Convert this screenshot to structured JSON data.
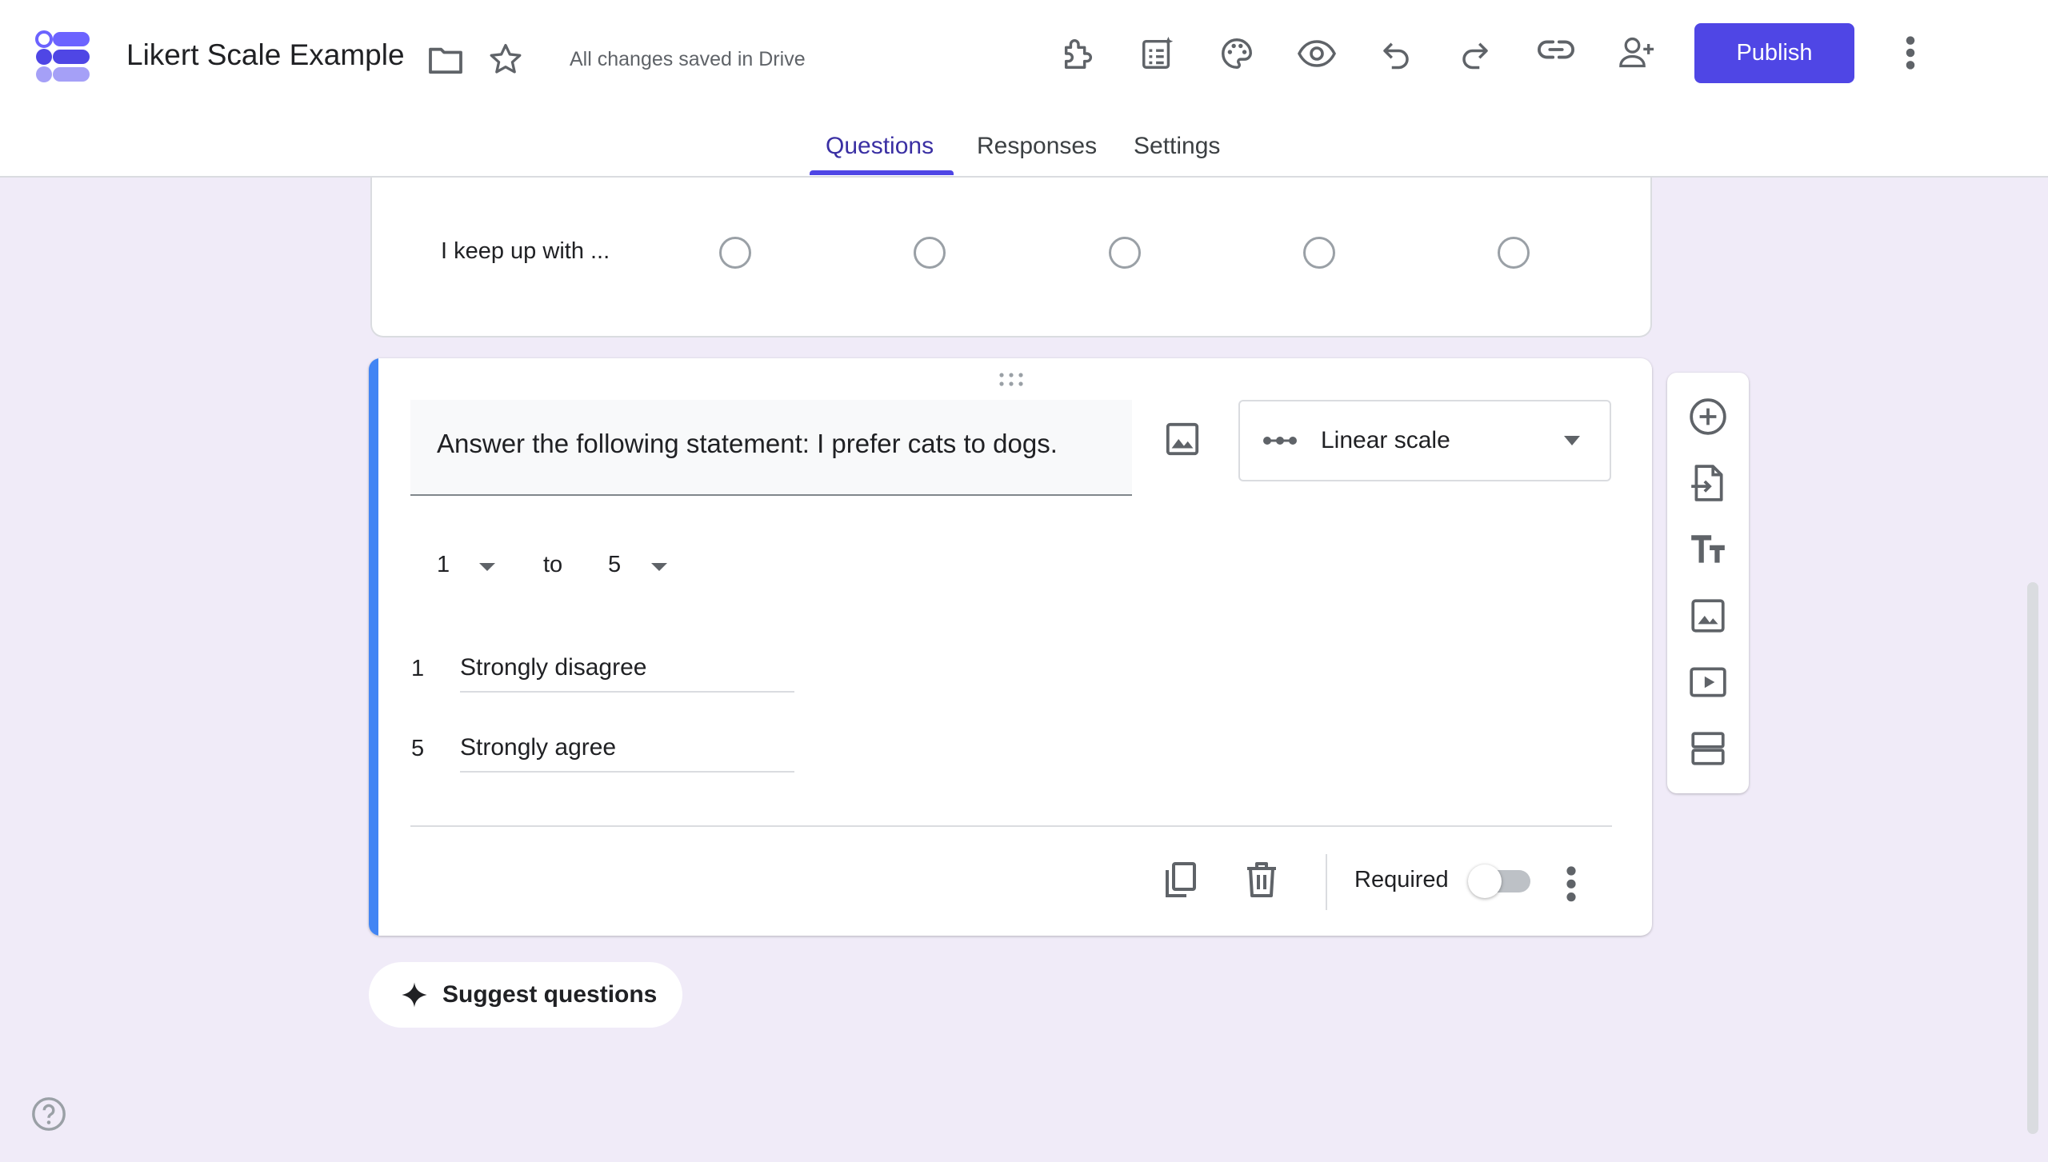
{
  "header": {
    "doc_title": "Likert Scale Example",
    "save_status": "All changes saved in Drive",
    "publish_label": "Publish",
    "colors": {
      "accent": "#4f46e5",
      "card_accent": "#4285f4",
      "background": "#f0ebf8"
    }
  },
  "icons": {
    "toolbar": [
      "add-ons-icon",
      "ai-form-icon",
      "palette-icon",
      "preview-icon",
      "undo-icon",
      "redo-icon",
      "link-icon",
      "add-collaborator-icon",
      "more-vert-icon"
    ],
    "side_toolbar": [
      "add-question-icon",
      "import-questions-icon",
      "add-title-icon",
      "add-image-icon",
      "add-video-icon",
      "add-section-icon"
    ]
  },
  "tabs": [
    {
      "label": "Questions",
      "active": true
    },
    {
      "label": "Responses",
      "active": false
    },
    {
      "label": "Settings",
      "active": false
    }
  ],
  "prev_card": {
    "row_label": "I keep up with ..."
  },
  "question": {
    "title": "Answer the following statement: I prefer cats to dogs.",
    "type": "Linear scale",
    "range_from": "1",
    "range_to": "5",
    "range_separator": "to",
    "min_num": "1",
    "min_label": "Strongly disagree",
    "max_num": "5",
    "max_label": "Strongly agree",
    "required_label": "Required",
    "required": false
  },
  "suggest_label": "Suggest questions"
}
